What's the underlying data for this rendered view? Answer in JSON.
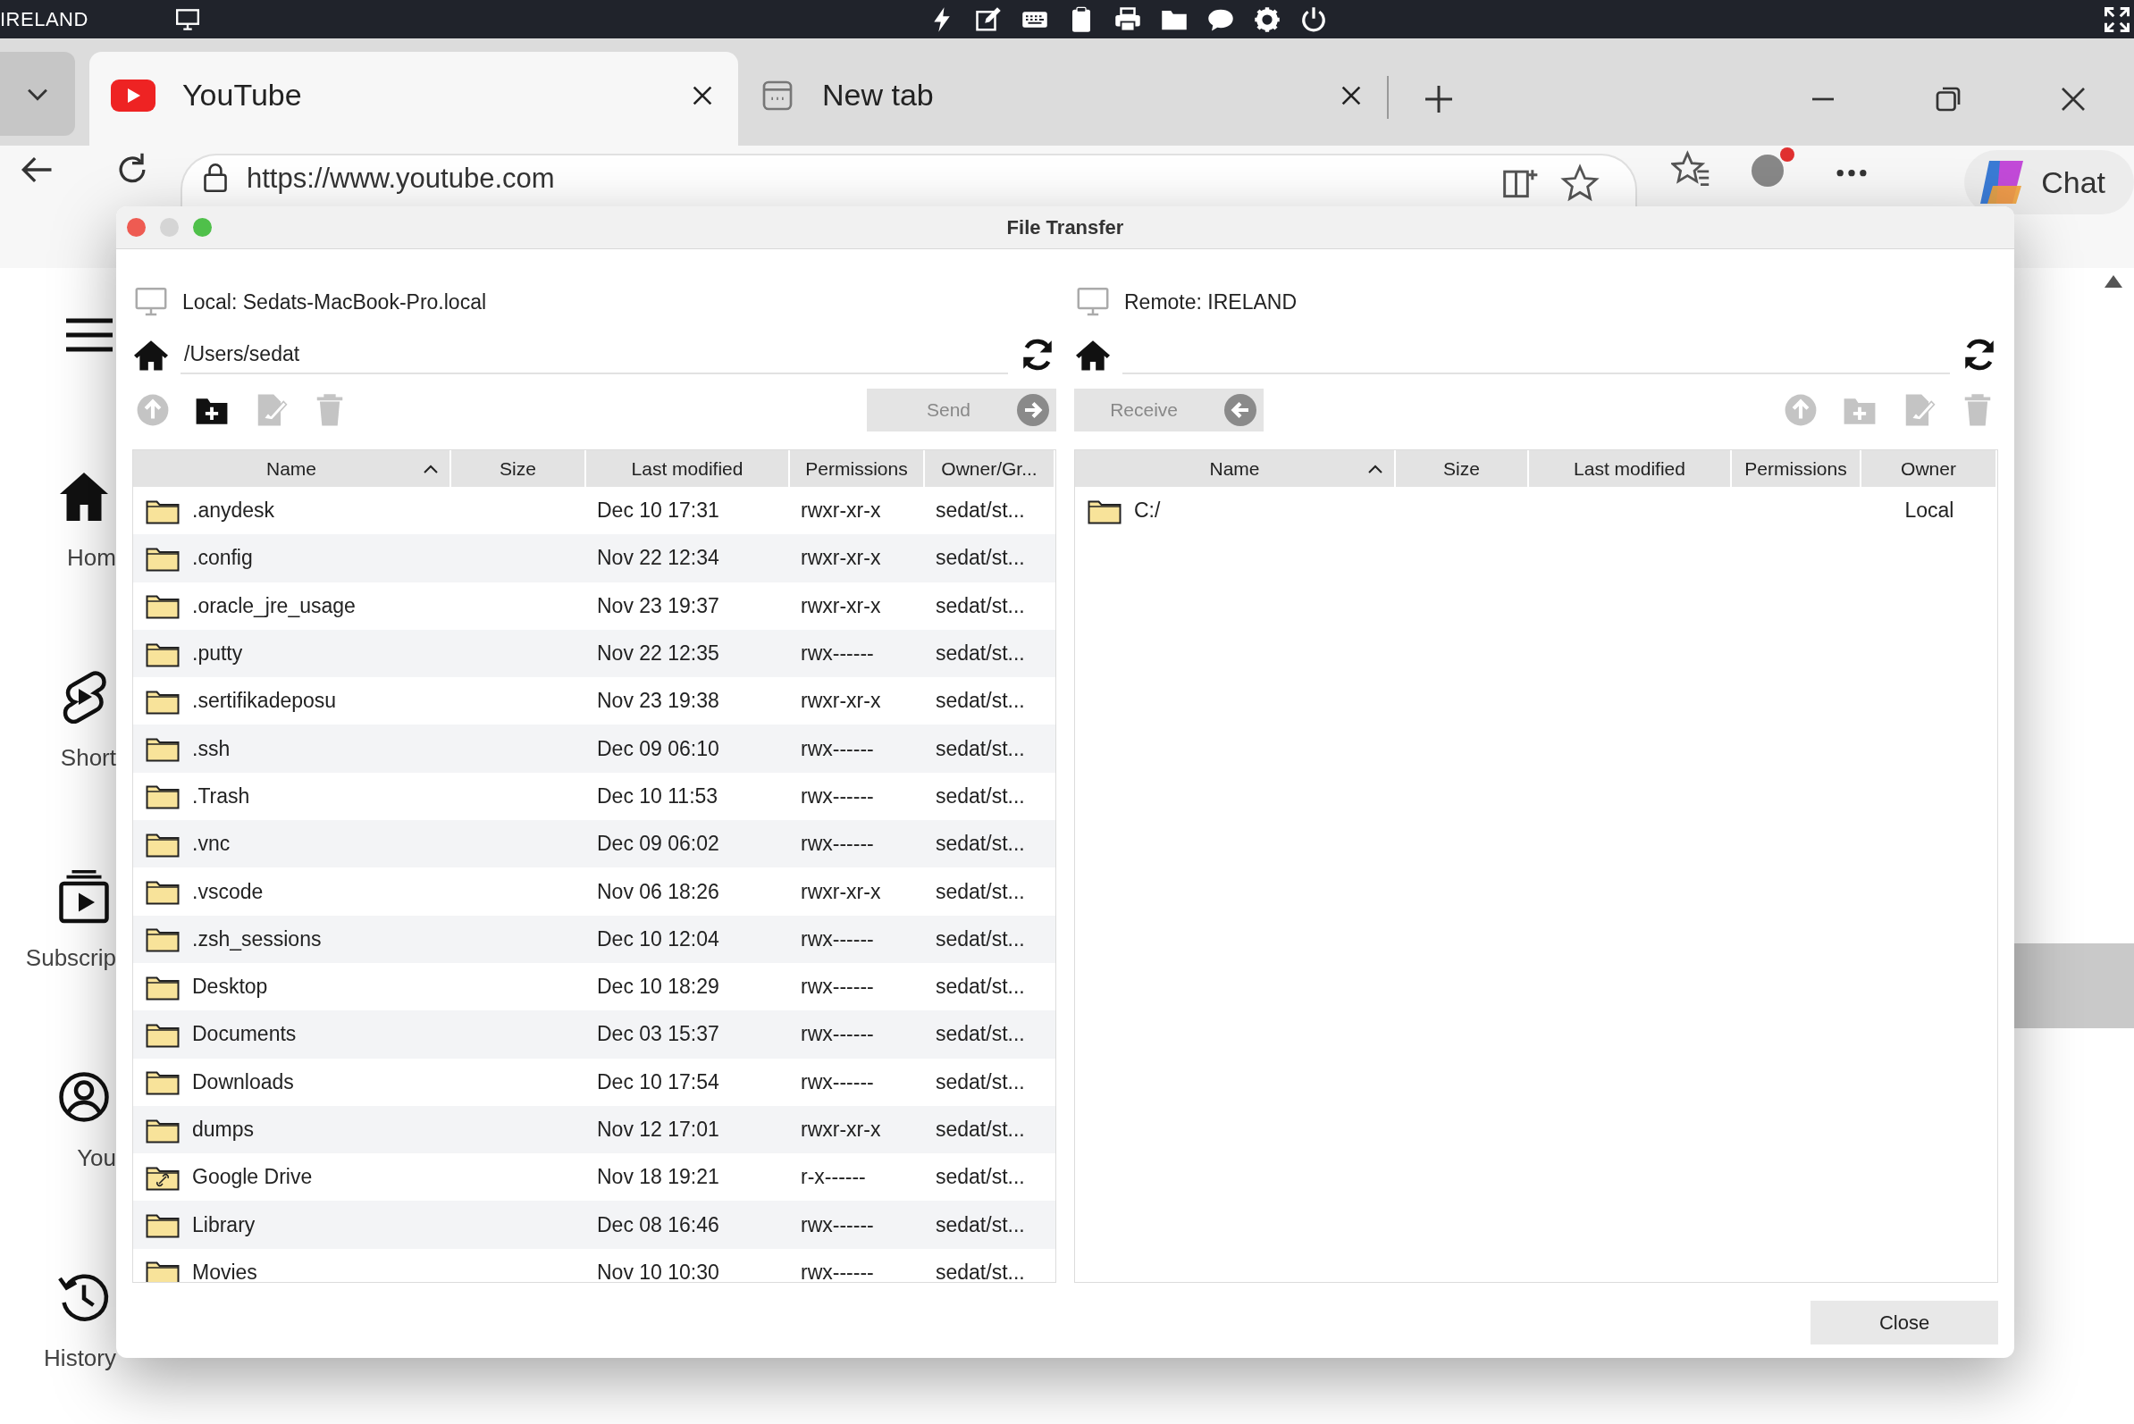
{
  "remote_bar": {
    "label": "IRELAND"
  },
  "browser": {
    "tabs": [
      {
        "title": "YouTube",
        "kind": "youtube",
        "selected": true
      },
      {
        "title": "New tab",
        "kind": "blank",
        "selected": false
      }
    ],
    "address": {
      "url": "https://www.youtube.com"
    },
    "chat_button": {
      "label": "Chat"
    }
  },
  "sidebar": {
    "items": [
      {
        "label": "Hom",
        "kind": "home"
      },
      {
        "label": "Short",
        "kind": "shorts"
      },
      {
        "label": "Subscrip",
        "kind": "subscriptions"
      },
      {
        "label": "You",
        "kind": "you"
      },
      {
        "label": "History",
        "kind": "history"
      }
    ]
  },
  "dialog": {
    "title": "File Transfer",
    "local": {
      "host": "Local: Sedats-MacBook-Pro.local",
      "path": "/Users/sedat",
      "tools": [
        {
          "kind": "up",
          "disabled": true
        },
        {
          "kind": "new_folder",
          "disabled": false
        },
        {
          "kind": "rename",
          "disabled": true
        },
        {
          "kind": "delete",
          "disabled": true
        }
      ],
      "action": {
        "label": "Send",
        "kind": "send",
        "disabled": true
      },
      "columns": [
        {
          "label": "Name",
          "sorted": true
        },
        {
          "label": "Size",
          "sorted": false
        },
        {
          "label": "Last modified",
          "sorted": false
        },
        {
          "label": "Permissions",
          "sorted": false
        },
        {
          "label": "Owner/Gr...",
          "sorted": false
        }
      ],
      "rows": [
        {
          "kind": "folder",
          "name": ".anydesk",
          "modified": "Dec 10 17:31",
          "permissions": "rwxr-xr-x",
          "owner": "sedat/st..."
        },
        {
          "kind": "folder",
          "name": ".config",
          "modified": "Nov 22 12:34",
          "permissions": "rwxr-xr-x",
          "owner": "sedat/st..."
        },
        {
          "kind": "folder",
          "name": ".oracle_jre_usage",
          "modified": "Nov 23 19:37",
          "permissions": "rwxr-xr-x",
          "owner": "sedat/st..."
        },
        {
          "kind": "folder",
          "name": ".putty",
          "modified": "Nov 22 12:35",
          "permissions": "rwx------",
          "owner": "sedat/st..."
        },
        {
          "kind": "folder",
          "name": ".sertifikadeposu",
          "modified": "Nov 23 19:38",
          "permissions": "rwxr-xr-x",
          "owner": "sedat/st..."
        },
        {
          "kind": "folder",
          "name": ".ssh",
          "modified": "Dec 09 06:10",
          "permissions": "rwx------",
          "owner": "sedat/st..."
        },
        {
          "kind": "folder",
          "name": ".Trash",
          "modified": "Dec 10 11:53",
          "permissions": "rwx------",
          "owner": "sedat/st..."
        },
        {
          "kind": "folder",
          "name": ".vnc",
          "modified": "Dec 09 06:02",
          "permissions": "rwx------",
          "owner": "sedat/st..."
        },
        {
          "kind": "folder",
          "name": ".vscode",
          "modified": "Nov 06 18:26",
          "permissions": "rwxr-xr-x",
          "owner": "sedat/st..."
        },
        {
          "kind": "folder",
          "name": ".zsh_sessions",
          "modified": "Dec 10 12:04",
          "permissions": "rwx------",
          "owner": "sedat/st..."
        },
        {
          "kind": "folder",
          "name": "Desktop",
          "modified": "Dec 10 18:29",
          "permissions": "rwx------",
          "owner": "sedat/st..."
        },
        {
          "kind": "folder",
          "name": "Documents",
          "modified": "Dec 03 15:37",
          "permissions": "rwx------",
          "owner": "sedat/st..."
        },
        {
          "kind": "folder",
          "name": "Downloads",
          "modified": "Dec 10 17:54",
          "permissions": "rwx------",
          "owner": "sedat/st..."
        },
        {
          "kind": "folder",
          "name": "dumps",
          "modified": "Nov 12 17:01",
          "permissions": "rwxr-xr-x",
          "owner": "sedat/st..."
        },
        {
          "kind": "linked_folder",
          "name": "Google Drive",
          "modified": "Nov 18 19:21",
          "permissions": "r-x------",
          "owner": "sedat/st..."
        },
        {
          "kind": "folder",
          "name": "Library",
          "modified": "Dec 08 16:46",
          "permissions": "rwx------",
          "owner": "sedat/st..."
        },
        {
          "kind": "folder",
          "name": "Movies",
          "modified": "Nov 10 10:30",
          "permissions": "rwx------",
          "owner": "sedat/st..."
        }
      ]
    },
    "remote": {
      "host": "Remote: IRELAND",
      "tools": [
        {
          "kind": "up",
          "disabled": true
        },
        {
          "kind": "new_folder",
          "disabled": true
        },
        {
          "kind": "rename",
          "disabled": true
        },
        {
          "kind": "delete",
          "disabled": true
        }
      ],
      "action": {
        "label": "Receive",
        "kind": "receive",
        "disabled": true
      },
      "columns": [
        {
          "label": "Name",
          "sorted": true
        },
        {
          "label": "Size",
          "sorted": false
        },
        {
          "label": "Last modified",
          "sorted": false
        },
        {
          "label": "Permissions",
          "sorted": false
        },
        {
          "label": "Owner",
          "sorted": false
        }
      ],
      "rows": [
        {
          "kind": "folder",
          "name": "C:/",
          "owner": "Local"
        }
      ]
    },
    "close_button": {
      "label": "Close"
    }
  }
}
